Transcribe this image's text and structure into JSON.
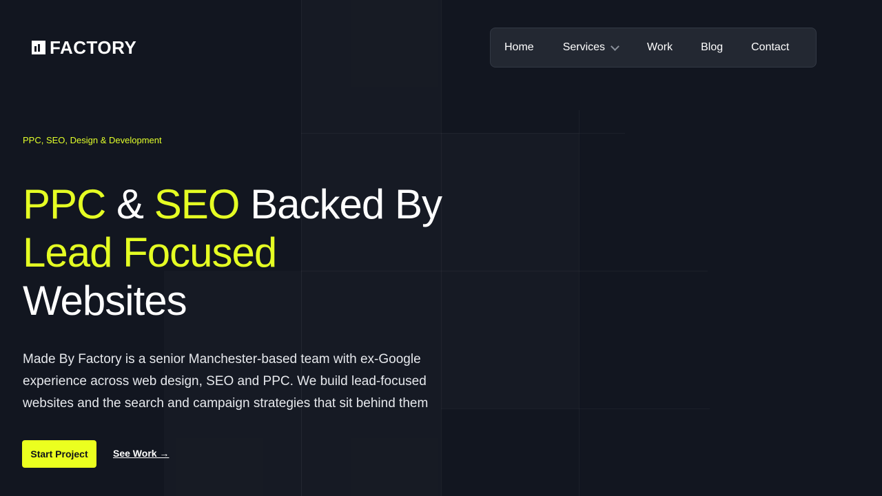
{
  "brand": {
    "logo_text": "FACTORY"
  },
  "nav": {
    "items": [
      {
        "label": "Home"
      },
      {
        "label": "Services"
      },
      {
        "label": "Work"
      },
      {
        "label": "Blog"
      },
      {
        "label": "Contact"
      }
    ]
  },
  "hero": {
    "eyebrow": "PPC, SEO, Design & Development",
    "headline": {
      "part1_accent": "PPC",
      "part2": "&",
      "part3_accent": "SEO",
      "part4": "Backed By",
      "part5_accent": "Lead Focused",
      "part6": "Websites"
    },
    "body": "Made By Factory is a senior Manchester-based team with ex-Google experience across web design, SEO and PPC. We build lead-focused websites and the search and campaign strategies that sit behind them",
    "primary_cta": "Start Project",
    "secondary_cta": "See Work →"
  },
  "colors": {
    "background": "#121620",
    "accent": "#e5ff23",
    "nav_background": "#232832",
    "text": "#ffffff"
  }
}
